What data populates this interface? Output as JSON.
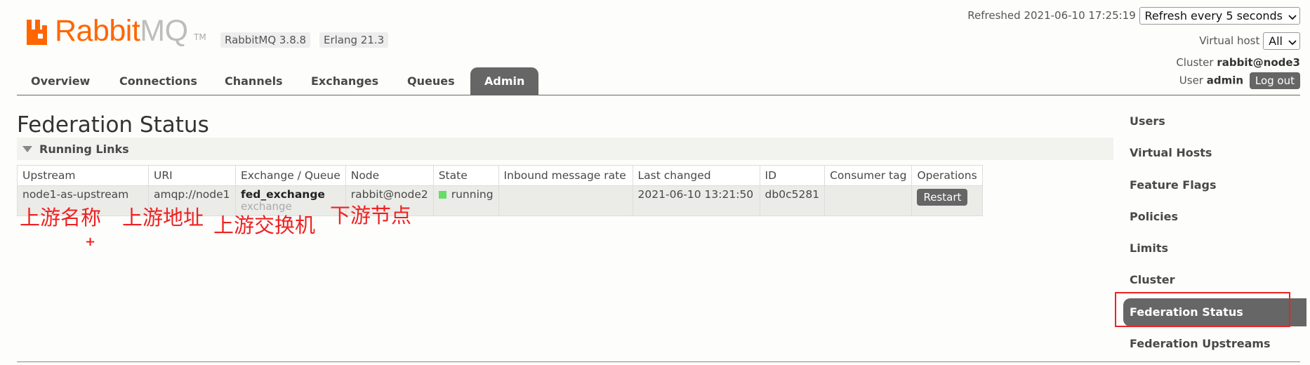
{
  "brand": {
    "logo_word_1": "Rabbit",
    "logo_word_2": "MQ",
    "logo_tm": "TM"
  },
  "versions": {
    "rabbitmq": "RabbitMQ 3.8.8",
    "erlang": "Erlang 21.3"
  },
  "header": {
    "refreshed_label": "Refreshed",
    "refreshed_value": "2021-06-10 17:25:19",
    "refresh_select": "Refresh every 5 seconds",
    "vhost_label": "Virtual host",
    "vhost_select": "All",
    "cluster_label": "Cluster",
    "cluster_value": "rabbit@node3",
    "user_label": "User",
    "user_value": "admin",
    "logout_label": "Log out"
  },
  "tabs": [
    {
      "label": "Overview"
    },
    {
      "label": "Connections"
    },
    {
      "label": "Channels"
    },
    {
      "label": "Exchanges"
    },
    {
      "label": "Queues"
    },
    {
      "label": "Admin",
      "active": true
    }
  ],
  "main": {
    "title": "Federation Status",
    "section_label": "Running Links",
    "table": {
      "headers": [
        "Upstream",
        "URI",
        "Exchange / Queue",
        "Node",
        "State",
        "Inbound message rate",
        "Last changed",
        "ID",
        "Consumer tag",
        "Operations"
      ],
      "rows": [
        {
          "upstream": "node1-as-upstream",
          "uri": "amqp://node1",
          "exchange_name": "fed_exchange",
          "exchange_type": "exchange",
          "node": "rabbit@node2",
          "state": "running",
          "inbound_rate": "",
          "last_changed": "2021-06-10 13:21:50",
          "id": "db0c5281",
          "consumer_tag": "",
          "operation": "Restart"
        }
      ]
    }
  },
  "annotations": {
    "upstream_name": "上游名称",
    "upstream_address": "上游地址",
    "upstream_exchange": "上游交换机",
    "downstream_node": "下游节点",
    "plus": "+"
  },
  "sidebar": {
    "items": [
      {
        "label": "Users"
      },
      {
        "label": "Virtual Hosts"
      },
      {
        "label": "Feature Flags"
      },
      {
        "label": "Policies"
      },
      {
        "label": "Limits"
      },
      {
        "label": "Cluster"
      },
      {
        "label": "Federation Status",
        "active": true
      },
      {
        "label": "Federation Upstreams"
      }
    ]
  },
  "colors": {
    "brand_orange": "#ff6600",
    "active_tab": "#666666",
    "annotation_red": "#ee2222",
    "running_green": "#66dd66"
  }
}
